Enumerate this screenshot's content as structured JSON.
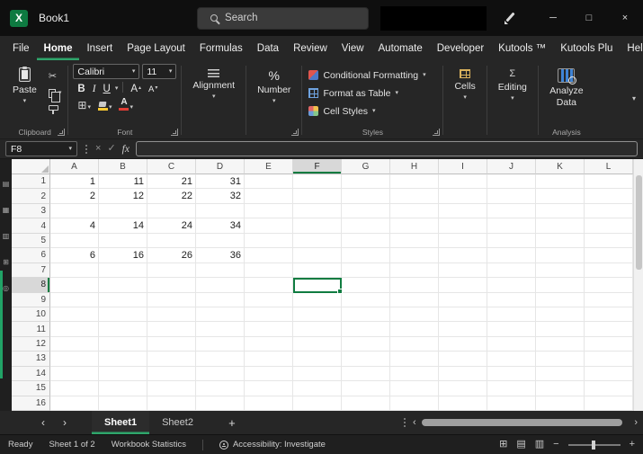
{
  "colors": {
    "accent_green": "#21a366",
    "selection_green": "#107c41"
  },
  "icons": {
    "logo_x": "X",
    "dropdown": "▾",
    "tri_up": "▴",
    "tri_down": "▾",
    "letter_A": "A",
    "sigma": "Σ",
    "scissors": "✂",
    "borders": "⊞",
    "percent": "%",
    "check": "✓",
    "close": "×",
    "minimize": "─",
    "maximize": "□",
    "chevron_left": "‹",
    "chevron_right": "›",
    "share_arrow": "↗",
    "minus": "−",
    "plus": "+",
    "view_normal": "⊞",
    "view_layout": "▤",
    "view_break": "▥",
    "panel_icon_1": "▤",
    "panel_icon_2": "▦",
    "panel_icon_3": "▥",
    "panel_icon_4": "⊞",
    "panel_icon_5": "◎"
  },
  "titlebar": {
    "title": "Book1",
    "search_placeholder": "Search"
  },
  "menubar": {
    "tabs": [
      {
        "label": "File"
      },
      {
        "label": "Home",
        "active": true
      },
      {
        "label": "Insert"
      },
      {
        "label": "Page Layout"
      },
      {
        "label": "Formulas"
      },
      {
        "label": "Data"
      },
      {
        "label": "Review"
      },
      {
        "label": "View"
      },
      {
        "label": "Automate"
      },
      {
        "label": "Developer"
      },
      {
        "label": "Kutools ™"
      },
      {
        "label": "Kutools Plu"
      },
      {
        "label": "Help"
      }
    ]
  },
  "ribbon": {
    "clipboard": {
      "paste": "Paste",
      "label": "Clipboard"
    },
    "font": {
      "name": "Calibri",
      "size": "11",
      "bold": "B",
      "italic": "I",
      "underline": "U",
      "label": "Font"
    },
    "alignment": {
      "label": "Alignment"
    },
    "number": {
      "label": "Number"
    },
    "styles": {
      "conditional_formatting": "Conditional Formatting",
      "format_as_table": "Format as Table",
      "cell_styles": "Cell Styles",
      "label": "Styles"
    },
    "cells": {
      "label": "Cells"
    },
    "editing": {
      "label": "Editing"
    },
    "analyze": {
      "label": "Analyze Data"
    },
    "analysis_label": "Analysis"
  },
  "formula_bar": {
    "name_box": "F8",
    "fx_label": "fx",
    "formula_value": ""
  },
  "grid": {
    "columns": [
      "A",
      "B",
      "C",
      "D",
      "E",
      "F",
      "G",
      "H",
      "I",
      "J",
      "K",
      "L"
    ],
    "visible_rows": 16,
    "selected_cell": "F8",
    "selected_column": "F",
    "selected_row": 8,
    "cell_data": {
      "1": {
        "A": "1",
        "B": "11",
        "C": "21",
        "D": "31"
      },
      "2": {
        "A": "2",
        "B": "12",
        "C": "22",
        "D": "32"
      },
      "4": {
        "A": "4",
        "B": "14",
        "C": "24",
        "D": "34"
      },
      "6": {
        "A": "6",
        "B": "16",
        "C": "26",
        "D": "36"
      }
    }
  },
  "sheet_tabs": {
    "tabs": [
      {
        "label": "Sheet1",
        "active": true
      },
      {
        "label": "Sheet2",
        "active": false
      }
    ],
    "add_label": "+"
  },
  "status_bar": {
    "ready": "Ready",
    "sheet_info": "Sheet 1 of 2",
    "workbook_stats": "Workbook Statistics",
    "accessibility": "Accessibility: Investigate"
  }
}
